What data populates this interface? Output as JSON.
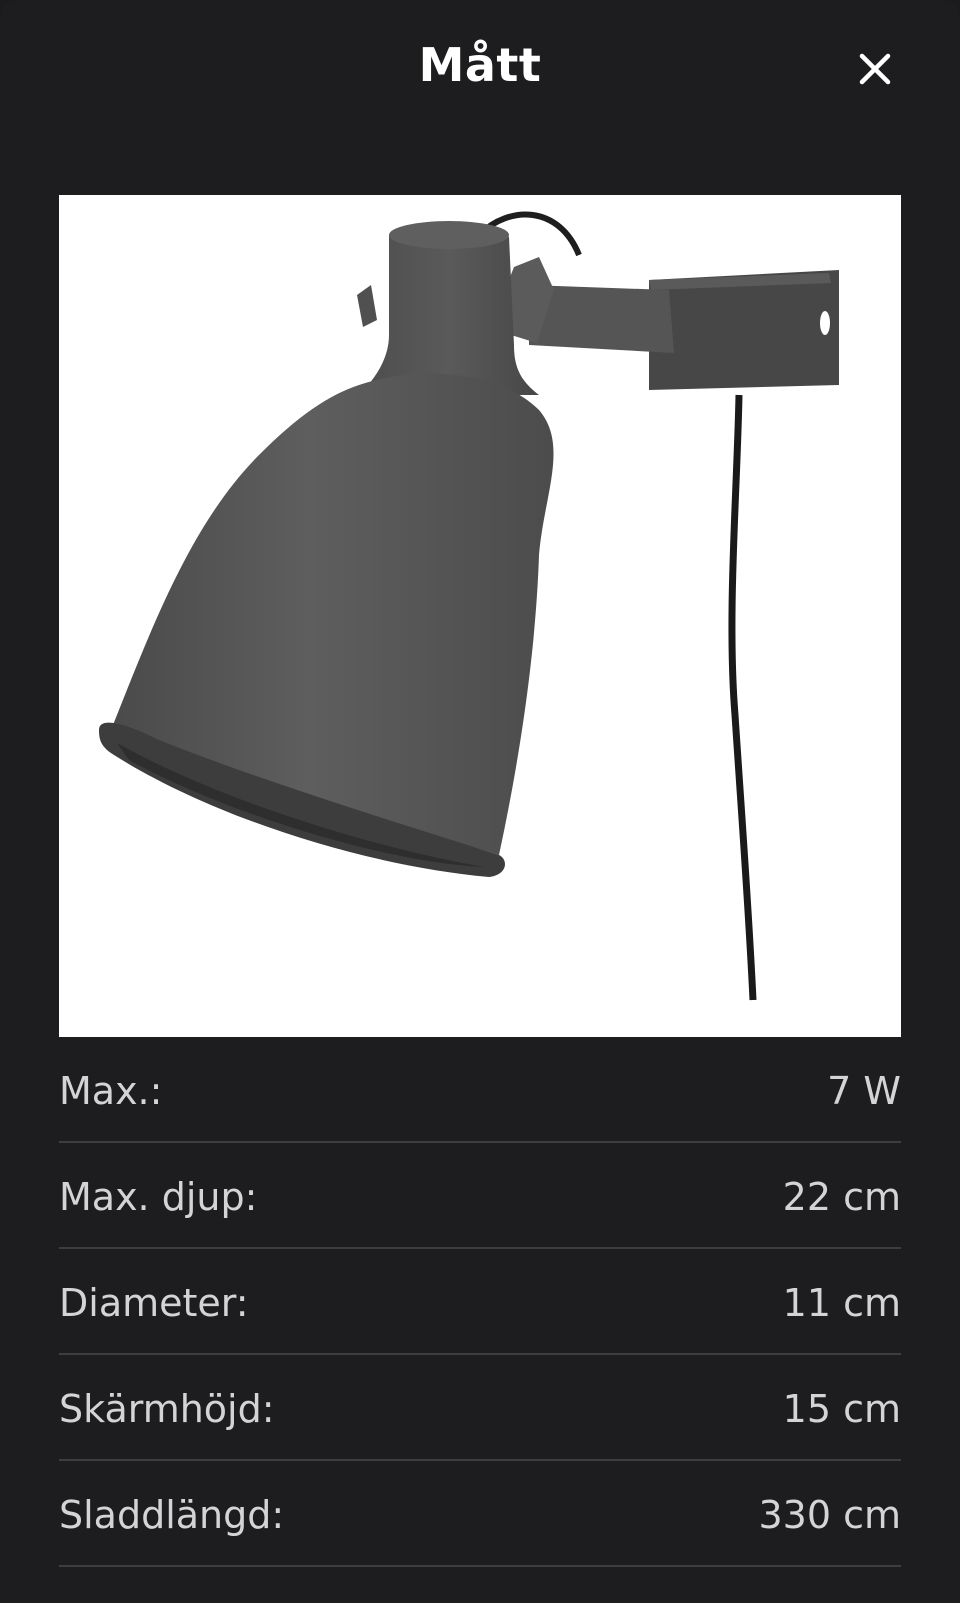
{
  "header": {
    "title": "Mått",
    "close_icon": "close-icon"
  },
  "product_image": {
    "background": "#ffffff",
    "subject_color": "#555555"
  },
  "specs": [
    {
      "label": "Max.:",
      "value": "7 W"
    },
    {
      "label": "Max. djup:",
      "value": "22 cm"
    },
    {
      "label": "Diameter:",
      "value": "11 cm"
    },
    {
      "label": "Skärmhöjd:",
      "value": "15 cm"
    },
    {
      "label": "Sladdlängd:",
      "value": "330 cm"
    }
  ],
  "colors": {
    "background": "#1d1d1f",
    "text": "#ffffff",
    "spec_text": "#d4d4d6",
    "divider": "#3d3d40"
  }
}
